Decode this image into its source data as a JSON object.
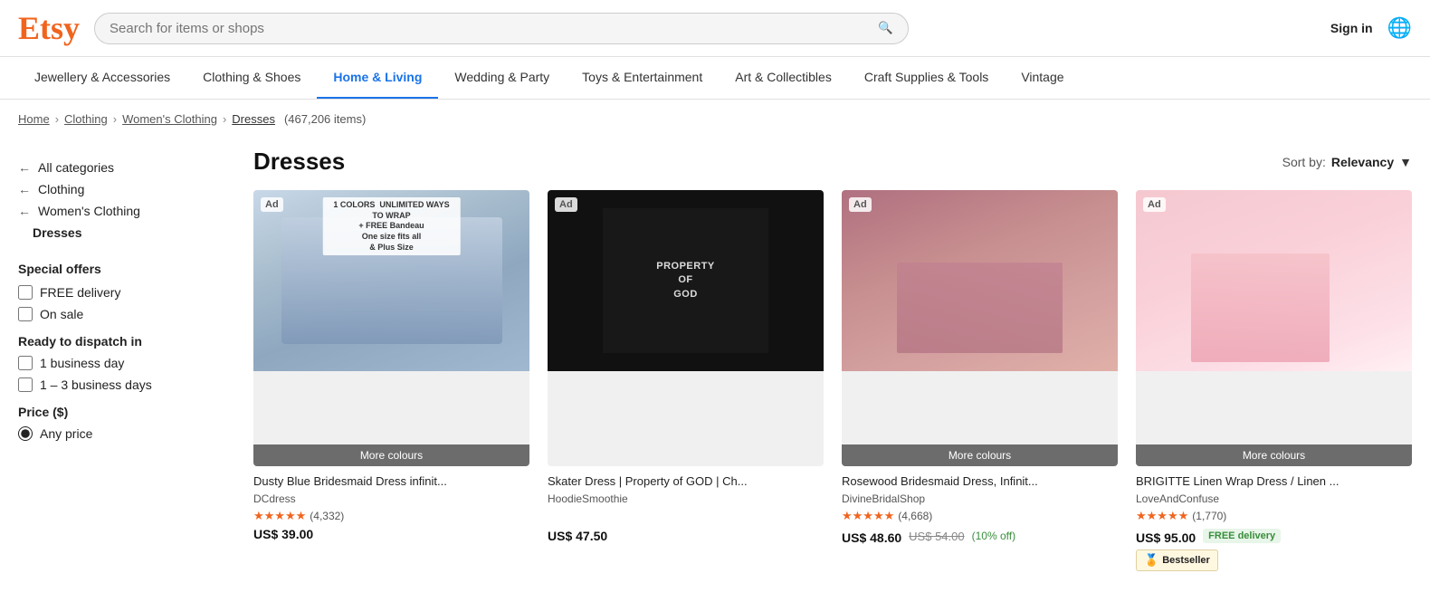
{
  "header": {
    "logo": "Etsy",
    "search_placeholder": "Search for items or shops",
    "sign_in": "Sign in"
  },
  "nav": {
    "items": [
      {
        "label": "Jewellery & Accessories",
        "active": false
      },
      {
        "label": "Clothing & Shoes",
        "active": false
      },
      {
        "label": "Home & Living",
        "active": true
      },
      {
        "label": "Wedding & Party",
        "active": false
      },
      {
        "label": "Toys & Entertainment",
        "active": false
      },
      {
        "label": "Art & Collectibles",
        "active": false
      },
      {
        "label": "Craft Supplies & Tools",
        "active": false
      },
      {
        "label": "Vintage",
        "active": false
      }
    ]
  },
  "breadcrumb": {
    "items": [
      {
        "label": "Home",
        "href": true
      },
      {
        "label": "Clothing",
        "href": true
      },
      {
        "label": "Women's Clothing",
        "href": true
      },
      {
        "label": "Dresses",
        "href": true
      }
    ],
    "count": "(467,206 items)"
  },
  "sidebar": {
    "categories": [
      {
        "label": "All categories",
        "arrow": "←"
      },
      {
        "label": "Clothing",
        "arrow": "←"
      },
      {
        "label": "Women's Clothing",
        "arrow": "←"
      },
      {
        "label": "Dresses",
        "active": true
      }
    ],
    "special_offers_title": "Special offers",
    "offers": [
      {
        "label": "FREE delivery"
      },
      {
        "label": "On sale"
      }
    ],
    "ready_title": "Ready to dispatch in",
    "ready_options": [
      {
        "label": "1 business day"
      },
      {
        "label": "1 – 3 business days"
      }
    ],
    "price_title": "Price ($)",
    "price_options": [
      {
        "label": "Any price",
        "selected": true
      }
    ]
  },
  "content": {
    "title": "Dresses",
    "sort_label": "Sort by:",
    "sort_value": "Relevancy",
    "products": [
      {
        "id": 1,
        "ad": true,
        "promo_text": "1 COLORS  UNLIMITED WAYS TO WRAP\n+ FREE Bandeau\nOne size fits all\n& Plus Size",
        "more_colours": true,
        "more_colours_label": "More colours",
        "title": "Dusty Blue Bridesmaid Dress infinit...",
        "shop": "DCdress",
        "stars": 5,
        "rating_count": "(4,332)",
        "price": "US$ 39.00",
        "image_style": "blue"
      },
      {
        "id": 2,
        "ad": true,
        "more_colours": false,
        "title": "Skater Dress | Property of GOD | Ch...",
        "shop": "HoodieSmoothie",
        "stars": 0,
        "rating_count": "",
        "price": "US$ 47.50",
        "image_style": "black"
      },
      {
        "id": 3,
        "ad": true,
        "more_colours": true,
        "more_colours_label": "More colours",
        "title": "Rosewood Bridesmaid Dress, Infinit...",
        "shop": "DivineBridalShop",
        "stars": 5,
        "rating_count": "(4,668)",
        "price": "US$ 48.60",
        "original_price": "US$ 54.00",
        "discount": "(10% off)",
        "image_style": "rose"
      },
      {
        "id": 4,
        "ad": true,
        "more_colours": true,
        "more_colours_label": "More colours",
        "title": "BRIGITTE Linen Wrap Dress / Linen ...",
        "shop": "LoveAndConfuse",
        "stars": 5,
        "rating_count": "(1,770)",
        "price": "US$ 95.00",
        "free_delivery": "FREE delivery",
        "bestseller": true,
        "bestseller_label": "Bestseller",
        "image_style": "pink"
      }
    ]
  }
}
